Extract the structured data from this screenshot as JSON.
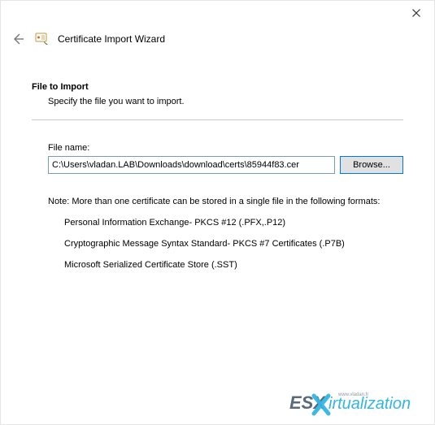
{
  "window": {
    "title": "Certificate Import Wizard"
  },
  "section": {
    "heading": "File to Import",
    "subheading": "Specify the file you want to import."
  },
  "file": {
    "label": "File name:",
    "value": "C:\\Users\\vladan.LAB\\Downloads\\download\\certs\\85944f83.cer",
    "browse_label": "Browse..."
  },
  "note": {
    "line1": "Note:  More than one certificate can be stored in a single file in the following formats:",
    "fmt1": "Personal Information Exchange- PKCS #12 (.PFX,.P12)",
    "fmt2": "Cryptographic Message Syntax Standard- PKCS #7 Certificates (.P7B)",
    "fmt3": "Microsoft Serialized Certificate Store (.SST)"
  },
  "watermark": {
    "text1": "ESX",
    "text2": "irtualization",
    "sub": "www.vladan.fr"
  }
}
